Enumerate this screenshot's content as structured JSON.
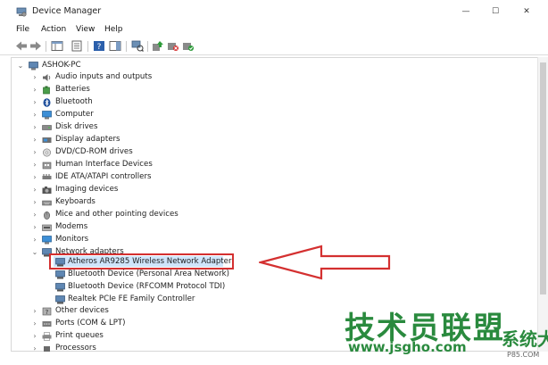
{
  "window": {
    "title": "Device Manager",
    "controls": {
      "minimize": "—",
      "maximize": "☐",
      "close": "✕"
    }
  },
  "menu": [
    "File",
    "Action",
    "View",
    "Help"
  ],
  "toolbar": {
    "icons": [
      "back-arrow-icon",
      "forward-arrow-icon",
      "show-hide-console-tree-icon",
      "properties-icon",
      "help-icon",
      "action-pane-icon",
      "computer-scan-icon",
      "update-driver-icon",
      "disable-device-icon",
      "uninstall-device-icon"
    ]
  },
  "tree": {
    "root": "ASHOK-PC",
    "categories": [
      {
        "label": "Audio inputs and outputs",
        "expanded": false
      },
      {
        "label": "Batteries",
        "expanded": false
      },
      {
        "label": "Bluetooth",
        "expanded": false
      },
      {
        "label": "Computer",
        "expanded": false
      },
      {
        "label": "Disk drives",
        "expanded": false
      },
      {
        "label": "Display adapters",
        "expanded": false
      },
      {
        "label": "DVD/CD-ROM drives",
        "expanded": false
      },
      {
        "label": "Human Interface Devices",
        "expanded": false
      },
      {
        "label": "IDE ATA/ATAPI controllers",
        "expanded": false
      },
      {
        "label": "Imaging devices",
        "expanded": false
      },
      {
        "label": "Keyboards",
        "expanded": false
      },
      {
        "label": "Mice and other pointing devices",
        "expanded": false
      },
      {
        "label": "Modems",
        "expanded": false
      },
      {
        "label": "Monitors",
        "expanded": false
      },
      {
        "label": "Network adapters",
        "expanded": true,
        "children": [
          "Atheros AR9285 Wireless Network Adapter",
          "Bluetooth Device (Personal Area Network)",
          "Bluetooth Device (RFCOMM Protocol TDI)",
          "Realtek PCIe FE Family Controller"
        ]
      },
      {
        "label": "Other devices",
        "expanded": false
      },
      {
        "label": "Ports (COM & LPT)",
        "expanded": false
      },
      {
        "label": "Print queues",
        "expanded": false
      },
      {
        "label": "Processors",
        "expanded": false
      }
    ],
    "selected": "Atheros AR9285 Wireless Network Adapter"
  },
  "chevrons": {
    "collapsed": "›",
    "expanded": "⌄"
  },
  "annotation": {
    "highlight_color": "#d43030"
  },
  "watermark": {
    "main": "技术员联盟",
    "extra": "系统大全",
    "url": "www.jsgho.com",
    "sub": "P85.COM"
  }
}
